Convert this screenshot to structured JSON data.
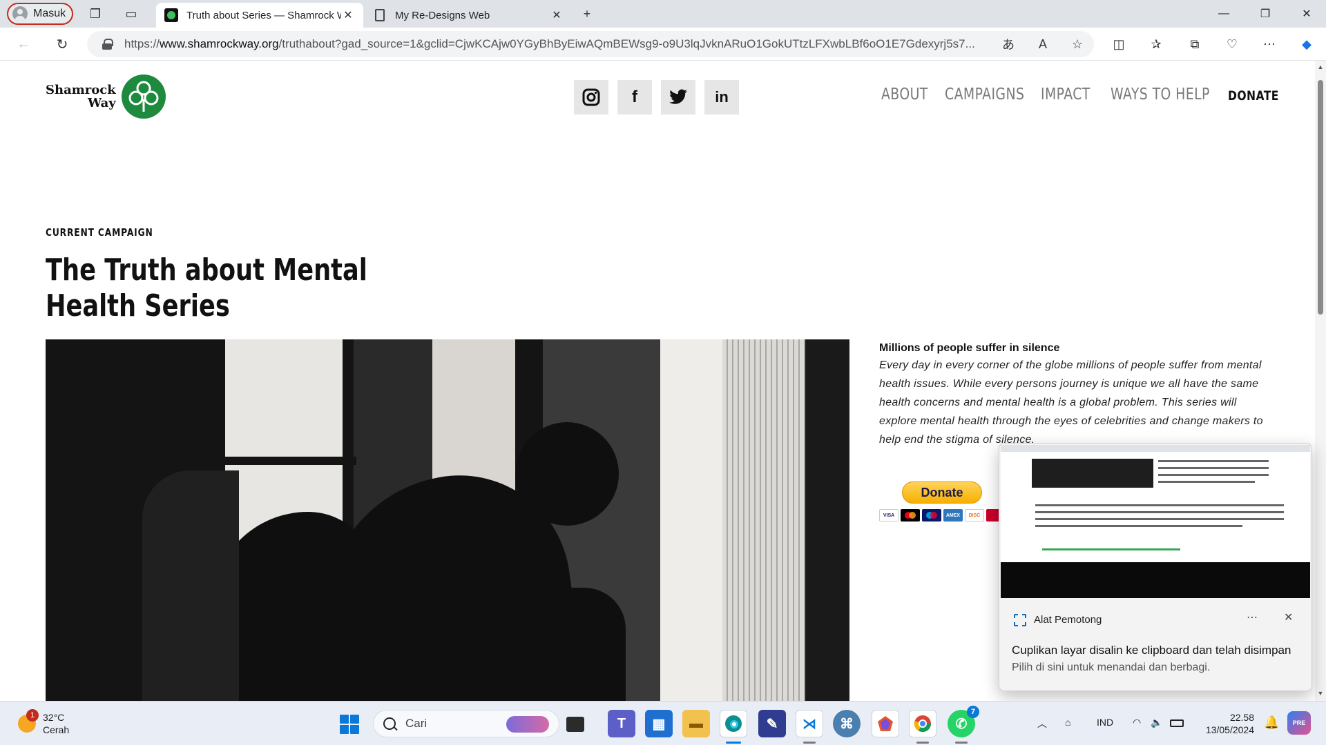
{
  "browser": {
    "profile_label": "Masuk",
    "tabs": [
      {
        "title": "Truth about Series — Shamrock Way",
        "active": true
      },
      {
        "title": "My Re-Designs Web",
        "active": false
      }
    ],
    "url_prefix": "https://",
    "url_domain": "www.shamrockway.org",
    "url_path": "/truthabout?gad_source=1&gclid=CjwKCAjw0YGyBhByEiwAQmBEWsg9-o9U3lqJvknARuO1GokUTtzLFXwbLBf6oO1E7Gdexyrj5s7...",
    "new_tab_symbol": "+"
  },
  "site": {
    "logo_line1": "Shamrock",
    "logo_line2": "Way",
    "social": [
      {
        "name": "instagram-icon",
        "glyph": "◎"
      },
      {
        "name": "facebook-icon",
        "glyph": "f"
      },
      {
        "name": "twitter-icon",
        "glyph": "🐦"
      },
      {
        "name": "linkedin-icon",
        "glyph": "in"
      }
    ],
    "nav": [
      "ABOUT",
      "CAMPAIGNS",
      "IMPACT",
      "WAYS TO HELP"
    ],
    "donate_nav": "DONATE",
    "eyebrow": "CURRENT CAMPAIGN",
    "headline": "The Truth about Mental Health Series",
    "article_lead": "Millions of people suffer in silence",
    "article_body": "Every day in every corner of the globe millions of people suffer from mental health issues. While every persons journey is unique we all have the same health concerns and mental health is a global problem. This series will explore mental health through the eyes of celebrities and change makers to help end the stigma of silence.",
    "paypal_donate": "Donate",
    "cards": [
      {
        "label": "VISA",
        "color": "#ffffff",
        "text": "#1a1f71"
      },
      {
        "label": "MC",
        "color": "#000000",
        "text": "#ffffff"
      },
      {
        "label": "MAE",
        "color": "#0a1a6b",
        "text": "#ffffff"
      },
      {
        "label": "AMEX",
        "color": "#2e77bb",
        "text": "#ffffff"
      },
      {
        "label": "DISC",
        "color": "#ffffff",
        "text": "#e27a1f"
      },
      {
        "label": "",
        "color": "#c9002b",
        "text": "#ffffff"
      }
    ]
  },
  "toast": {
    "app_name": "Alat Pemotong",
    "message": "Cuplikan layar disalin ke clipboard dan telah disimpan",
    "sub": "Pilih di sini untuk menandai dan berbagi."
  },
  "taskbar": {
    "temperature": "32°C",
    "weather_desc": "Cerah",
    "weather_badge": "1",
    "search_placeholder": "Cari",
    "language": "IND",
    "time": "22.58",
    "date": "13/05/2024",
    "whatsapp_badge": "7",
    "copilot_label": "PRE"
  },
  "colors": {
    "brand_green": "#1e8a3e",
    "paypal_yellow": "#f7b000",
    "accent_blue": "#0a78d7"
  }
}
